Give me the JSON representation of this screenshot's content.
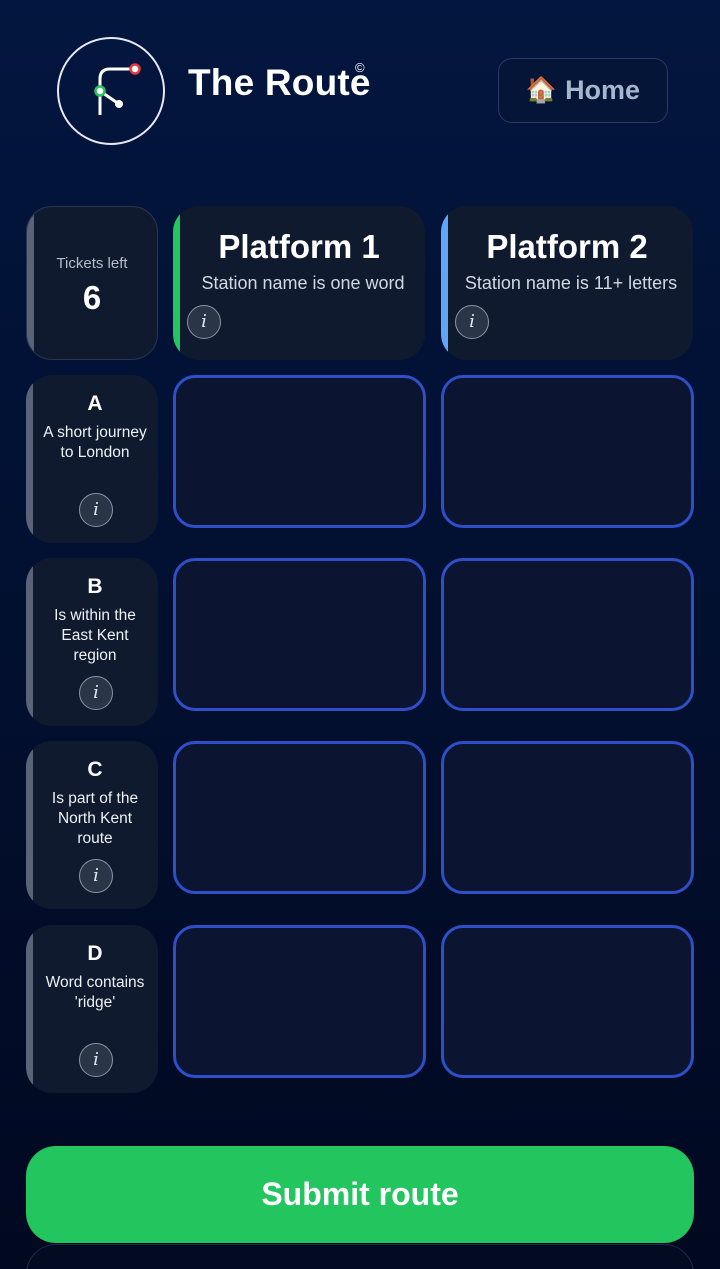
{
  "header": {
    "title": "The Route",
    "copyright_mark": "©",
    "home_icon": "🏠",
    "home_label": "Home"
  },
  "tickets": {
    "label": "Tickets left",
    "count": "6"
  },
  "platforms": [
    {
      "title": "Platform 1",
      "rule": "Station name is one word",
      "accent": "#22c55e",
      "info_icon": "i"
    },
    {
      "title": "Platform 2",
      "rule": "Station name is 11+ letters",
      "accent": "#60a5fa",
      "info_icon": "i"
    }
  ],
  "rows": [
    {
      "letter": "A",
      "rule": "A short journey to London",
      "info_icon": "i"
    },
    {
      "letter": "B",
      "rule": "Is within the East Kent region",
      "info_icon": "i"
    },
    {
      "letter": "C",
      "rule": "Is part of the North Kent route",
      "info_icon": "i"
    },
    {
      "letter": "D",
      "rule": "Word contains 'ridge'",
      "info_icon": "i"
    }
  ],
  "grid_cells": [
    [
      "",
      ""
    ],
    [
      "",
      ""
    ],
    [
      "",
      ""
    ],
    [
      "",
      ""
    ]
  ],
  "actions": {
    "submit_label": "Submit route"
  },
  "colors": {
    "background": "#03163f",
    "card": "#0f1a2e",
    "slot_border": "#2f4fc9",
    "submit": "#22c55e"
  }
}
